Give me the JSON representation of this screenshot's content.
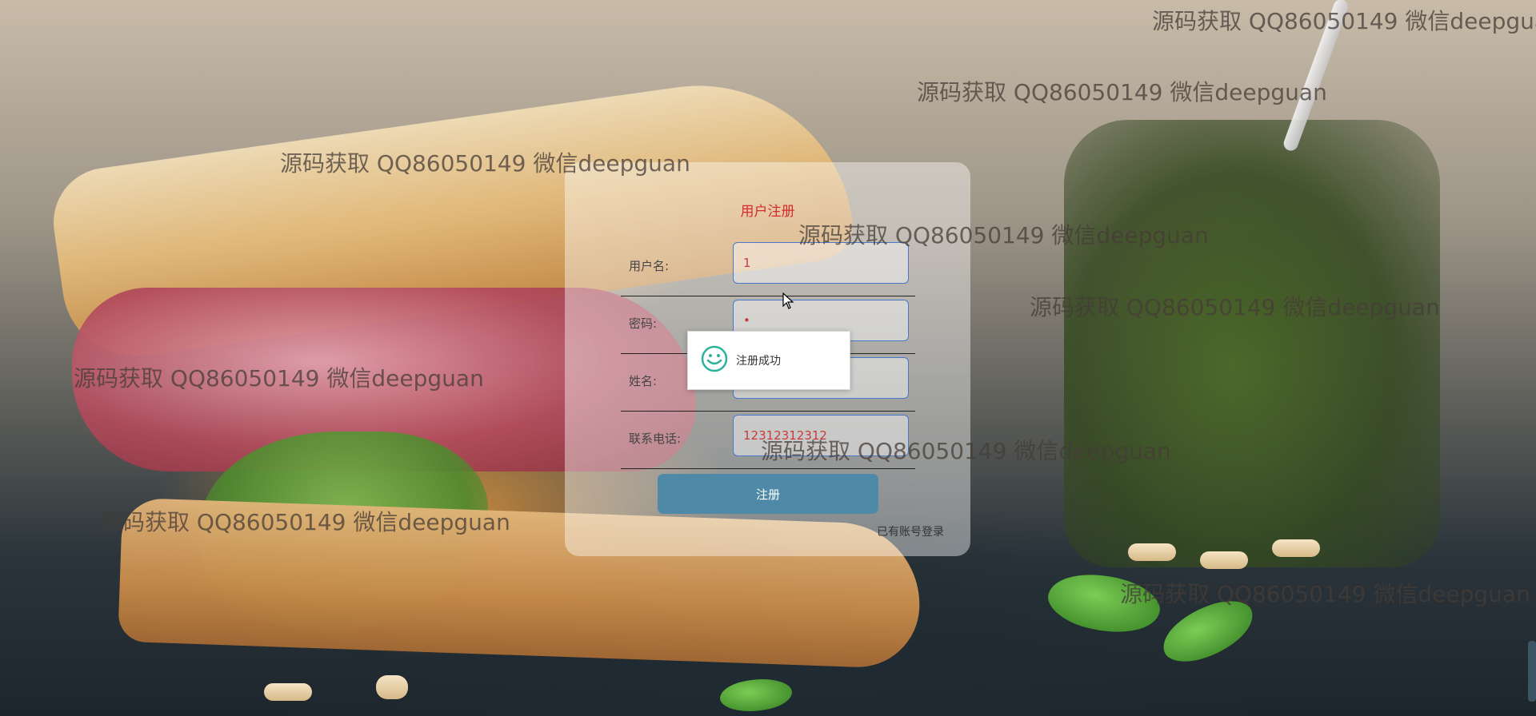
{
  "form": {
    "title": "用户注册",
    "fields": [
      {
        "label": "用户名:",
        "value": "1"
      },
      {
        "label": "密码:",
        "value": "•"
      },
      {
        "label": "姓名:",
        "value": ""
      },
      {
        "label": "联系电话:",
        "value": "12312312312"
      }
    ],
    "submit_label": "注册",
    "login_link": "已有账号登录"
  },
  "toast": {
    "message": "注册成功",
    "icon": "smile-icon"
  },
  "watermark": {
    "text": "源码获取 QQ86050149 微信deepguan"
  },
  "colors": {
    "title_red": "#d52a2a",
    "button_blue": "#4e8aa8",
    "input_border": "#4a78c9",
    "toast_icon": "#2ab39a"
  }
}
